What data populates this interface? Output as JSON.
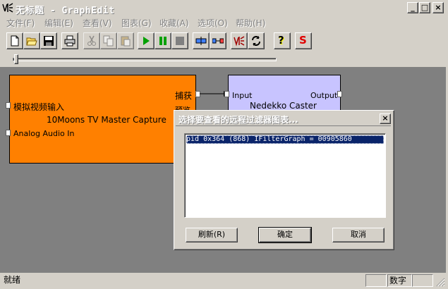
{
  "window": {
    "title": "无标题 - GraphEdit",
    "minimize": "_",
    "maximize": "□",
    "close": "×"
  },
  "menu": [
    {
      "label": "文件(F)"
    },
    {
      "label": "编辑(E)"
    },
    {
      "label": "查看(V)"
    },
    {
      "label": "图表(G)"
    },
    {
      "label": "收藏(A)"
    },
    {
      "label": "选项(O)"
    },
    {
      "label": "帮助(H)"
    }
  ],
  "toolbar": {
    "icons": [
      "new-file-icon",
      "open-folder-icon",
      "save-icon",
      "print-icon",
      "cut-icon",
      "copy-icon",
      "paste-icon",
      "play-icon",
      "pause-icon",
      "stop-icon",
      "seek-icon",
      "connect-icon",
      "mute-icon",
      "refresh-icon",
      "help-icon",
      "s-icon"
    ],
    "s_label": "S",
    "help_label": "?"
  },
  "seek": {
    "position": 0.0
  },
  "filters": {
    "capture": {
      "name": "10Moons TV Master Capture",
      "pin_video_in": "模拟视频输入",
      "pin_audio_in": "Analog Audio In",
      "pin_capture": "捕获",
      "pin_preview": "预览",
      "color": "#ff8000"
    },
    "caster": {
      "name": "Nedekko Caster",
      "pin_input": "Input",
      "pin_output": "Output",
      "color": "#c8c4ff"
    }
  },
  "dialog": {
    "title": "选择要查看的远程过滤器图表...",
    "close": "×",
    "list_items": [
      "pid 0x364  (868)  IFilterGraph = 00905860"
    ],
    "buttons": {
      "refresh": "刷新(R)",
      "ok": "确定",
      "cancel": "取消"
    }
  },
  "status": {
    "text": "就绪",
    "numlock": "数字"
  }
}
